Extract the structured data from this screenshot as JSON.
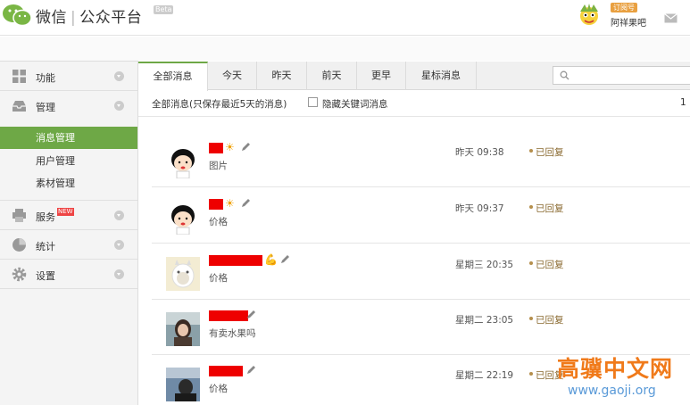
{
  "header": {
    "brand_left": "微信",
    "brand_right": "公众平台",
    "beta": "Beta",
    "subscription_badge": "订阅号",
    "account_name": "阿祥果吧",
    "icons": [
      "wechat-logo-icon",
      "mail-icon"
    ]
  },
  "sidebar": {
    "sections": [
      {
        "label": "功能",
        "icon": "grid-icon"
      },
      {
        "label": "管理",
        "icon": "inbox-icon"
      },
      {
        "label": "服务",
        "icon": "printer-icon",
        "badge": "NEW"
      },
      {
        "label": "统计",
        "icon": "pie-icon"
      },
      {
        "label": "设置",
        "icon": "gear-icon"
      }
    ],
    "manage_items": [
      "消息管理",
      "用户管理",
      "素材管理"
    ]
  },
  "tabs": [
    "全部消息",
    "今天",
    "昨天",
    "前天",
    "更早",
    "星标消息"
  ],
  "search": {
    "placeholder": ""
  },
  "filter": {
    "note": "全部消息(只保存最近5天的消息)",
    "checkbox_label": "隐藏关键词消息",
    "page_count": "1"
  },
  "messages": [
    {
      "preview": "图片",
      "time": "昨天 09:38",
      "status": "已回复",
      "emoji": "☀"
    },
    {
      "preview": "价格",
      "time": "昨天 09:37",
      "status": "已回复",
      "emoji": "☀"
    },
    {
      "preview": "价格",
      "time": "星期三 20:35",
      "status": "已回复",
      "emoji": "💪"
    },
    {
      "preview": "有卖水果吗",
      "time": "星期二 23:05",
      "status": "已回复",
      "emoji": ""
    },
    {
      "preview": "价格",
      "time": "星期二 22:19",
      "status": "已回复",
      "emoji": ""
    }
  ],
  "watermark": {
    "cn": "高骥中文网",
    "url": "www.gaoji.org"
  },
  "colors": {
    "accent": "#6ea846",
    "redact": "#e00000",
    "replied": "#8a6a30"
  }
}
